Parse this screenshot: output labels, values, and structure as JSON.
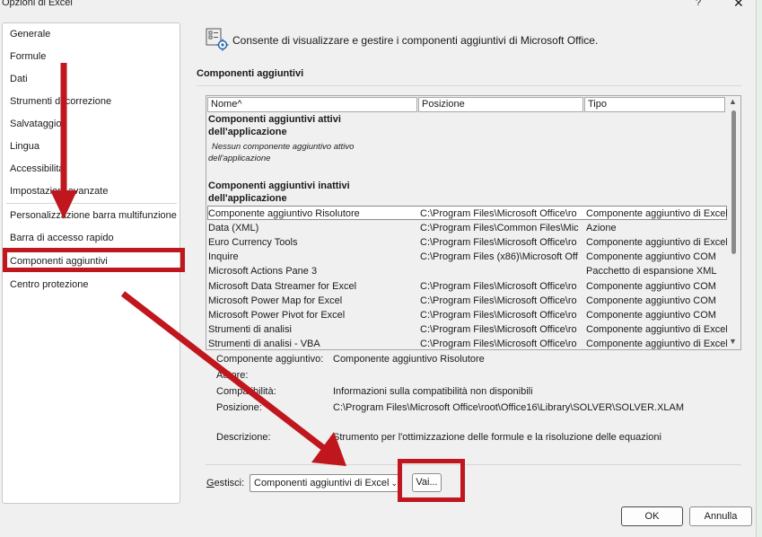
{
  "window": {
    "title": "Opzioni di Excel",
    "help_glyph": "?",
    "close_glyph": "✕"
  },
  "sidebar": {
    "items": [
      {
        "label": "Generale"
      },
      {
        "label": "Formule"
      },
      {
        "label": "Dati"
      },
      {
        "label": "Strumenti di correzione"
      },
      {
        "label": "Salvataggio"
      },
      {
        "label": "Lingua"
      },
      {
        "label": "Accessibilità"
      },
      {
        "label": "Impostazioni avanzate"
      },
      {
        "label": "Personalizzazione barra multifunzione"
      },
      {
        "label": "Barra di accesso rapido"
      },
      {
        "label": "Componenti aggiuntivi",
        "selected": true
      },
      {
        "label": "Centro protezione"
      }
    ]
  },
  "main": {
    "header_text": "Consente di visualizzare e gestire i componenti aggiuntivi di Microsoft Office.",
    "section_title": "Componenti aggiuntivi",
    "columns": {
      "name": "Nome^",
      "location": "Posizione",
      "type": "Tipo"
    },
    "active_group": {
      "title_line1": "Componenti aggiuntivi attivi",
      "title_line2": "dell'applicazione",
      "empty_line1": "Nessun componente aggiuntivo attivo",
      "empty_line2": "dell'applicazione"
    },
    "inactive_group": {
      "title_line1": "Componenti aggiuntivi inattivi",
      "title_line2": "dell'applicazione"
    },
    "rows": [
      {
        "name": "Componente aggiuntivo Risolutore",
        "location": "C:\\Program Files\\Microsoft Office\\ro",
        "type": "Componente aggiuntivo di Excel",
        "selected": true
      },
      {
        "name": "Data (XML)",
        "location": "C:\\Program Files\\Common Files\\Mic",
        "type": "Azione"
      },
      {
        "name": "Euro Currency Tools",
        "location": "C:\\Program Files\\Microsoft Office\\ro",
        "type": "Componente aggiuntivo di Excel"
      },
      {
        "name": "Inquire",
        "location": "C:\\Program Files (x86)\\Microsoft Off",
        "type": "Componente aggiuntivo COM"
      },
      {
        "name": "Microsoft Actions Pane 3",
        "location": "",
        "type": "Pacchetto di espansione XML"
      },
      {
        "name": "Microsoft Data Streamer for Excel",
        "location": "C:\\Program Files\\Microsoft Office\\ro",
        "type": "Componente aggiuntivo COM"
      },
      {
        "name": "Microsoft Power Map for Excel",
        "location": "C:\\Program Files\\Microsoft Office\\ro",
        "type": "Componente aggiuntivo COM"
      },
      {
        "name": "Microsoft Power Pivot for Excel",
        "location": "C:\\Program Files\\Microsoft Office\\ro",
        "type": "Componente aggiuntivo COM"
      },
      {
        "name": "Strumenti di analisi",
        "location": "C:\\Program Files\\Microsoft Office\\ro",
        "type": "Componente aggiuntivo di Excel"
      },
      {
        "name": "Strumenti di analisi - VBA",
        "location": "C:\\Program Files\\Microsoft Office\\ro",
        "type": "Componente aggiuntivo di Excel"
      }
    ],
    "details": {
      "addin_label": "Componente aggiuntivo:",
      "addin_value": "Componente aggiuntivo Risolutore",
      "author_label": "Autore:",
      "author_value": "",
      "compat_label": "Compatibilità:",
      "compat_value": "Informazioni sulla compatibilità non disponibili",
      "location_label": "Posizione:",
      "location_value": "C:\\Program Files\\Microsoft Office\\root\\Office16\\Library\\SOLVER\\SOLVER.XLAM",
      "description_label": "Descrizione:",
      "description_value": "Strumento per l'ottimizzazione delle formule e la risoluzione delle equazioni"
    },
    "manage": {
      "label_prefix": "",
      "label_underlined": "G",
      "label_rest": "estisci:",
      "selected_option": "Componenti aggiuntivi di Excel",
      "go_button": "Vai..."
    }
  },
  "footer": {
    "ok": "OK",
    "cancel": "Annulla"
  },
  "colors": {
    "annotation_red": "#c0171e"
  },
  "icons": {
    "header": "addins-gear-icon",
    "scroll_up": "triangle-up-icon",
    "scroll_down": "triangle-down-icon",
    "dropdown": "chevron-down-icon"
  }
}
